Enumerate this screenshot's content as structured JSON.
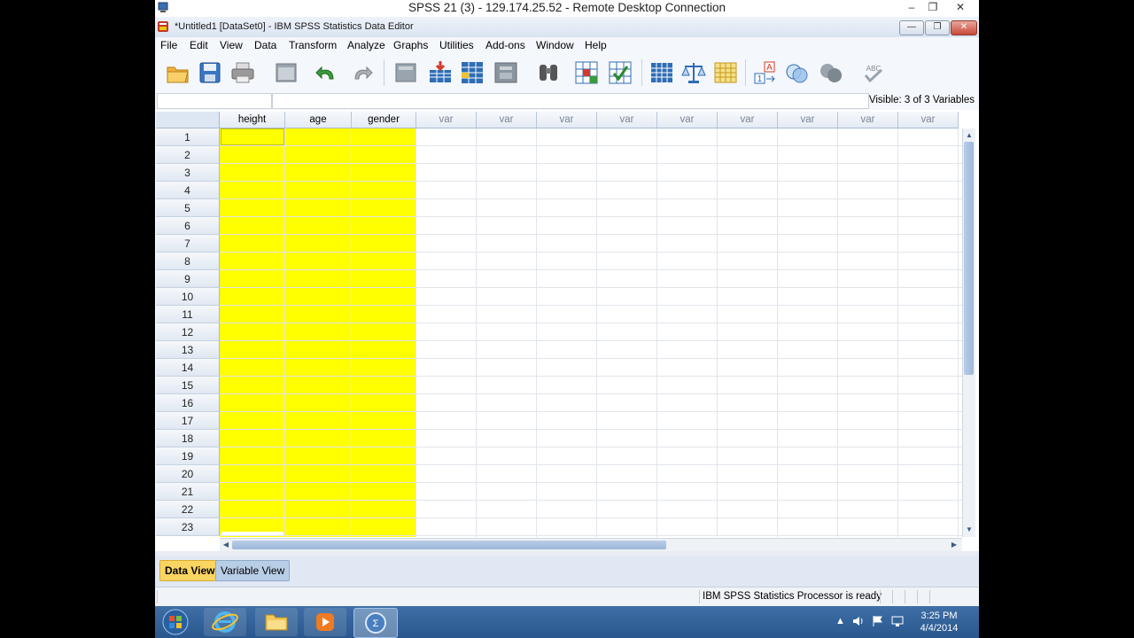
{
  "rdp": {
    "title": "SPSS 21 (3) - 129.174.25.52 - Remote Desktop Connection",
    "controls": {
      "minimize": "–",
      "restore": "❐",
      "close": "✕"
    }
  },
  "window": {
    "title": "*Untitled1 [DataSet0] - IBM SPSS Statistics Data Editor",
    "controls": {
      "minimize": "—",
      "restore": "❐",
      "close": "✕"
    }
  },
  "menu": [
    "File",
    "Edit",
    "View",
    "Data",
    "Transform",
    "Analyze",
    "Graphs",
    "Utilities",
    "Add-ons",
    "Window",
    "Help"
  ],
  "toolbar": {
    "icons": [
      "open-folder-icon",
      "save-icon",
      "print-icon",
      "dialog-recall-icon",
      "undo-icon",
      "redo-icon",
      "goto-case-icon",
      "goto-variable-icon",
      "insert-cases-icon",
      "insert-variable-icon",
      "find-icon",
      "split-file-icon",
      "select-cases-icon",
      "value-labels-icon",
      "weight-cases-icon",
      "variables-icon",
      "use-sets-icon",
      "show-all-icon",
      "spell-check-icon"
    ],
    "spell_label": "ABC",
    "label_icon_text": "A",
    "label_icon_num": "1"
  },
  "ref_row": {
    "visible_label": "Visible: 3 of 3 Variables"
  },
  "grid": {
    "columns": [
      "height",
      "age",
      "gender",
      "var",
      "var",
      "var",
      "var",
      "var",
      "var",
      "var",
      "var",
      "var"
    ],
    "rows": [
      "1",
      "2",
      "3",
      "4",
      "5",
      "6",
      "7",
      "8",
      "9",
      "10",
      "11",
      "12",
      "13",
      "14",
      "15",
      "16",
      "17",
      "18",
      "19",
      "20",
      "21",
      "22",
      "23"
    ],
    "highlight_color": "#ffff00"
  },
  "tabs": {
    "data_view": "Data View",
    "variable_view": "Variable View"
  },
  "status": {
    "text": "IBM SPSS Statistics Processor is ready"
  },
  "taskbar": {
    "apps": [
      "internet-explorer-icon",
      "file-explorer-icon",
      "media-player-icon",
      "spss-icon"
    ],
    "time": "3:25 PM",
    "date": "4/4/2014",
    "tray_arrow": "▲"
  }
}
